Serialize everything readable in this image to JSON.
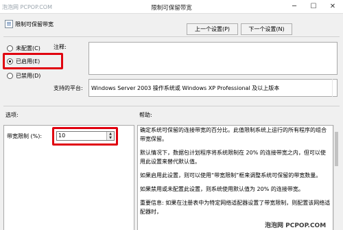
{
  "watermark_top": "泡泡网 PCPOP.COM",
  "window": {
    "title": "限制可保留带宽",
    "minimize": "─",
    "maximize": "☐",
    "close": "✕"
  },
  "header": {
    "title": "限制可保留带宽",
    "prev_button": "上一个设置(P)",
    "next_button": "下一个设置(N)"
  },
  "radios": [
    {
      "label": "未配置(C)",
      "selected": false
    },
    {
      "label": "已启用(E)",
      "selected": true
    },
    {
      "label": "已禁用(D)",
      "selected": false
    }
  ],
  "comment": {
    "label": "注释:",
    "value": ""
  },
  "platform": {
    "label": "支持的平台:",
    "value": "Windows Server 2003 操作系统或 Windows XP Professional 及以上版本"
  },
  "sections": {
    "options": "选项:",
    "help": "帮助:"
  },
  "bandwidth": {
    "label": "带宽限制 (%):",
    "value": "10",
    "up": "▲",
    "down": "▼"
  },
  "help_paragraphs": [
    "确定系统可保留的连接带宽的百分比。此值限制系统上运行的所有程序的组合带宽保留。",
    "默认情况下，数据包计划程序将系统限制在 20% 的连接带宽之内，但可以使用此设置来替代默认值。",
    "如果启用此设置，则可以使用“带宽限制”框来调整系统可保留的带宽数量。",
    "如果禁用或未配置此设置，则系统使用默认值为 20% 的连接带宽。",
    "重要信息: 如果在注册表中为特定网络适配器设置了带宽限制，则配置该网络适配器时，"
  ],
  "watermark_bottom": "泡泡网 PCPOP.COM",
  "colors": {
    "highlight": "#e0000e",
    "window_bg": "#f0f0f0"
  }
}
